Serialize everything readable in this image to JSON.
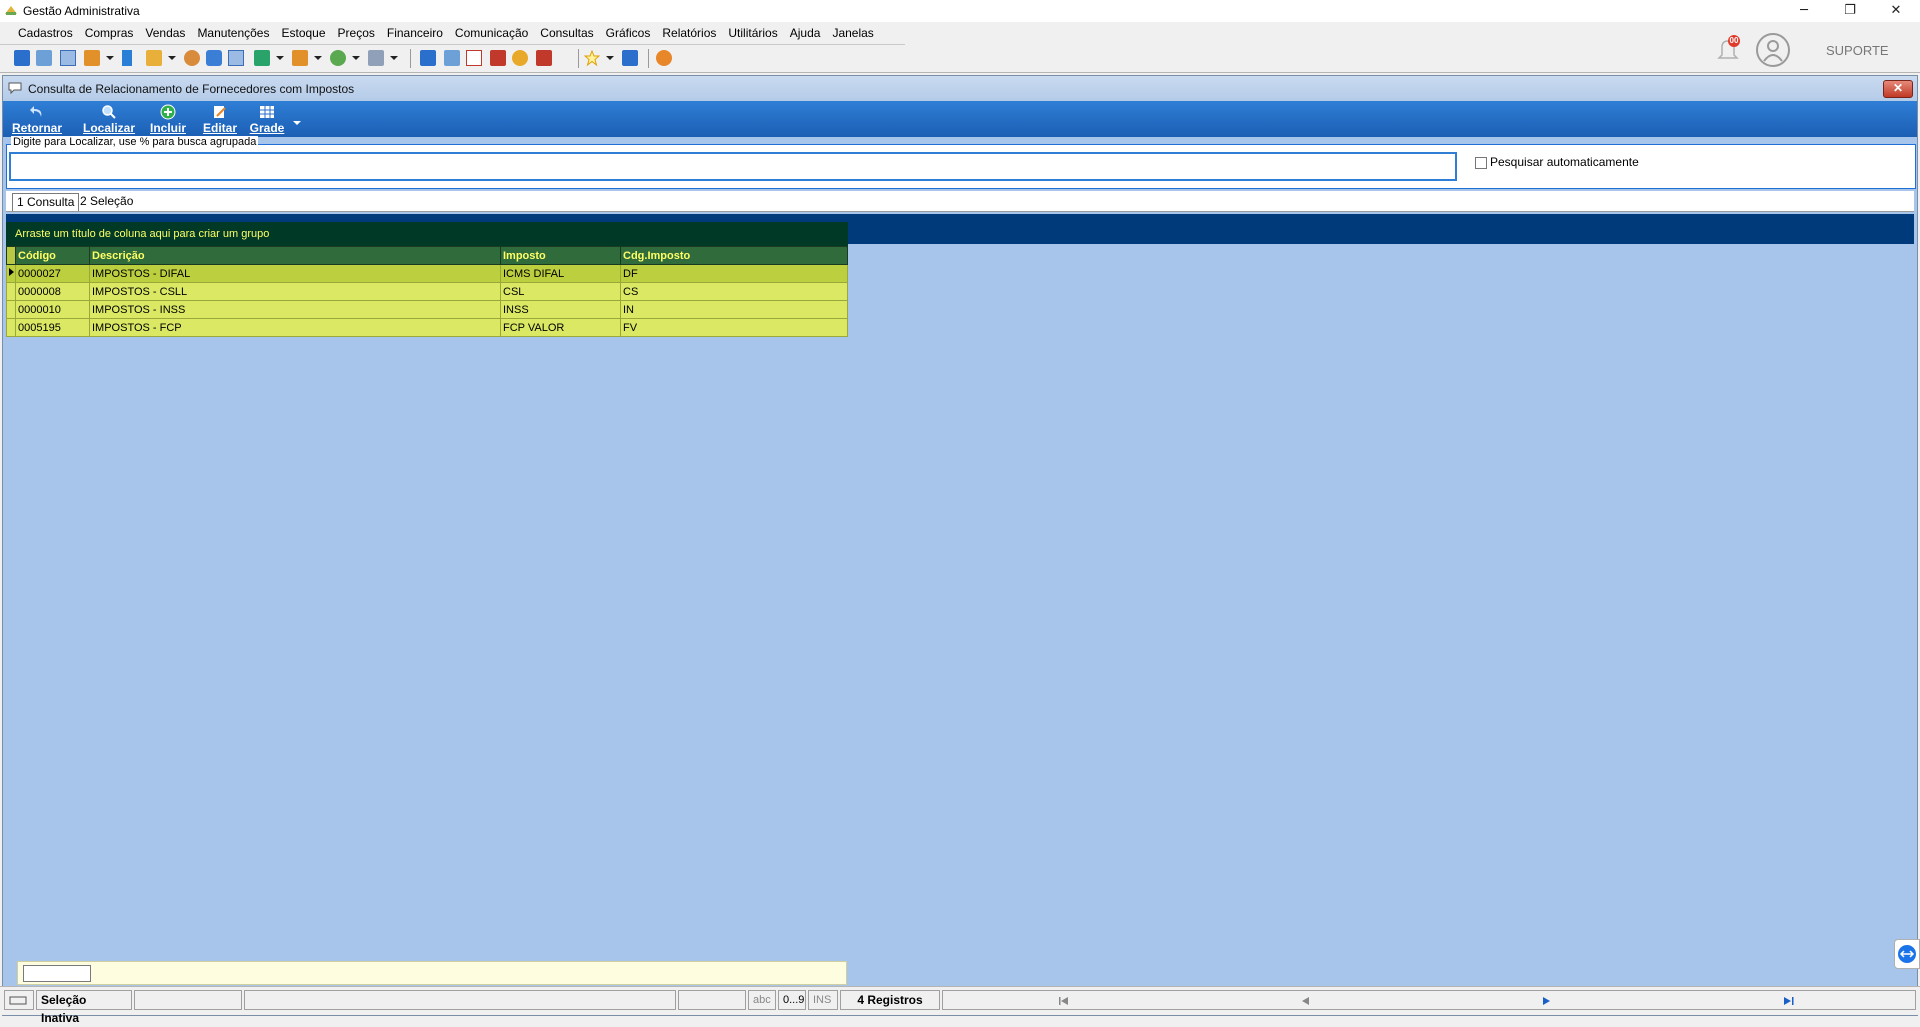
{
  "window": {
    "title": "Gestão Administrativa",
    "minimize": "─",
    "restore": "❐",
    "close": "✕"
  },
  "menu": [
    "Cadastros",
    "Compras",
    "Vendas",
    "Manutenções",
    "Estoque",
    "Preços",
    "Financeiro",
    "Comunicação",
    "Consultas",
    "Gráficos",
    "Relatórios",
    "Utilitários",
    "Ajuda",
    "Janelas"
  ],
  "header_right": {
    "notification_count": "00",
    "user": "SUPORTE"
  },
  "child": {
    "title": "Consulta de Relacionamento de Fornecedores com Impostos",
    "close": "✕"
  },
  "actions": {
    "retornar": "Retornar",
    "localizar": "Localizar",
    "incluir": "Incluir",
    "editar": "Editar",
    "grade": "Grade"
  },
  "search": {
    "label": "Digite para Localizar, use % para busca agrupada",
    "value": "",
    "auto_label": "Pesquisar automaticamente"
  },
  "tabs": {
    "tab1": "1 Consulta",
    "tab2": "2 Seleção"
  },
  "grid": {
    "group_hint": "Arraste um título de coluna aqui para criar um grupo",
    "columns": [
      "Código",
      "Descrição",
      "Imposto",
      "Cdg.Imposto"
    ],
    "rows": [
      [
        "0000027",
        "IMPOSTOS - DIFAL",
        "ICMS DIFAL",
        "DF"
      ],
      [
        "0000008",
        "IMPOSTOS - CSLL",
        "CSL",
        "CS"
      ],
      [
        "0000010",
        "IMPOSTOS - INSS",
        "INSS",
        "IN"
      ],
      [
        "0005195",
        "IMPOSTOS - FCP",
        "FCP VALOR",
        "FV"
      ]
    ]
  },
  "status": {
    "selection": "Seleção Inativa",
    "abc": "abc",
    "num": "0...9",
    "ins": "INS",
    "records": "4 Registros"
  },
  "colors": {
    "action_bar": "#1b5fb4",
    "grid_header": "#2f6b3b",
    "grid_row": "#dbe864",
    "workspace": "#a7c5ea"
  }
}
